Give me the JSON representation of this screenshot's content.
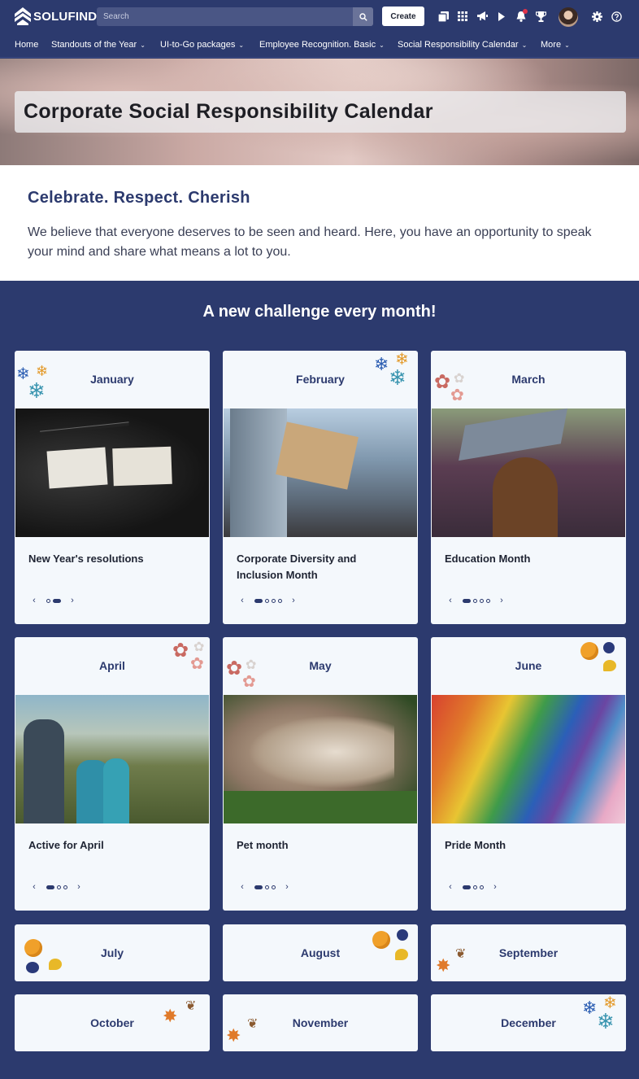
{
  "header": {
    "logo_text": "SOLUFIND",
    "search_placeholder": "Search",
    "create_label": "Create"
  },
  "nav": {
    "items": [
      {
        "label": "Home",
        "dropdown": false
      },
      {
        "label": "Standouts of the Year",
        "dropdown": true
      },
      {
        "label": "UI-to-Go packages",
        "dropdown": true
      },
      {
        "label": "Employee Recognition. Basic",
        "dropdown": true
      },
      {
        "label": "Social Responsibility Calendar",
        "dropdown": true
      },
      {
        "label": "More",
        "dropdown": true
      }
    ]
  },
  "banner": {
    "title": "Corporate Social Responsibility Calendar"
  },
  "intro": {
    "heading": "Celebrate. Respect. Cherish",
    "text": "We believe that everyone deserves to be seen and heard. Here, you have an opportunity to speak your mind and share what means a lot to you."
  },
  "section": {
    "title": "A new challenge every month!"
  },
  "months": [
    {
      "name": "January",
      "title": "New Year's resolutions",
      "dots": 2,
      "active_dot": 2,
      "decoration": "snowflake-icon"
    },
    {
      "name": "February",
      "title": "Corporate Diversity and Inclusion Month",
      "dots": 4,
      "active_dot": 1,
      "decoration": "snowflake-icon"
    },
    {
      "name": "March",
      "title": "Education Month",
      "dots": 4,
      "active_dot": 1,
      "decoration": "flower-icon"
    },
    {
      "name": "April",
      "title": "Active for April",
      "dots": 3,
      "active_dot": 1,
      "decoration": "flower-icon"
    },
    {
      "name": "May",
      "title": "Pet month",
      "dots": 3,
      "active_dot": 1,
      "decoration": "flower-icon"
    },
    {
      "name": "June",
      "title": "Pride Month",
      "dots": 3,
      "active_dot": 1,
      "decoration": "fruit-icon"
    },
    {
      "name": "July",
      "decoration": "fruit-icon"
    },
    {
      "name": "August",
      "decoration": "fruit-icon"
    },
    {
      "name": "September",
      "decoration": "autumn-leaf-icon"
    },
    {
      "name": "October",
      "decoration": "autumn-leaf-icon"
    },
    {
      "name": "November",
      "decoration": "autumn-leaf-icon"
    },
    {
      "name": "December",
      "decoration": "snowflake-icon"
    }
  ],
  "colors": {
    "brand": "#2c3a6e",
    "card_bg": "#f4f8fc",
    "notification": "#e0334a"
  }
}
